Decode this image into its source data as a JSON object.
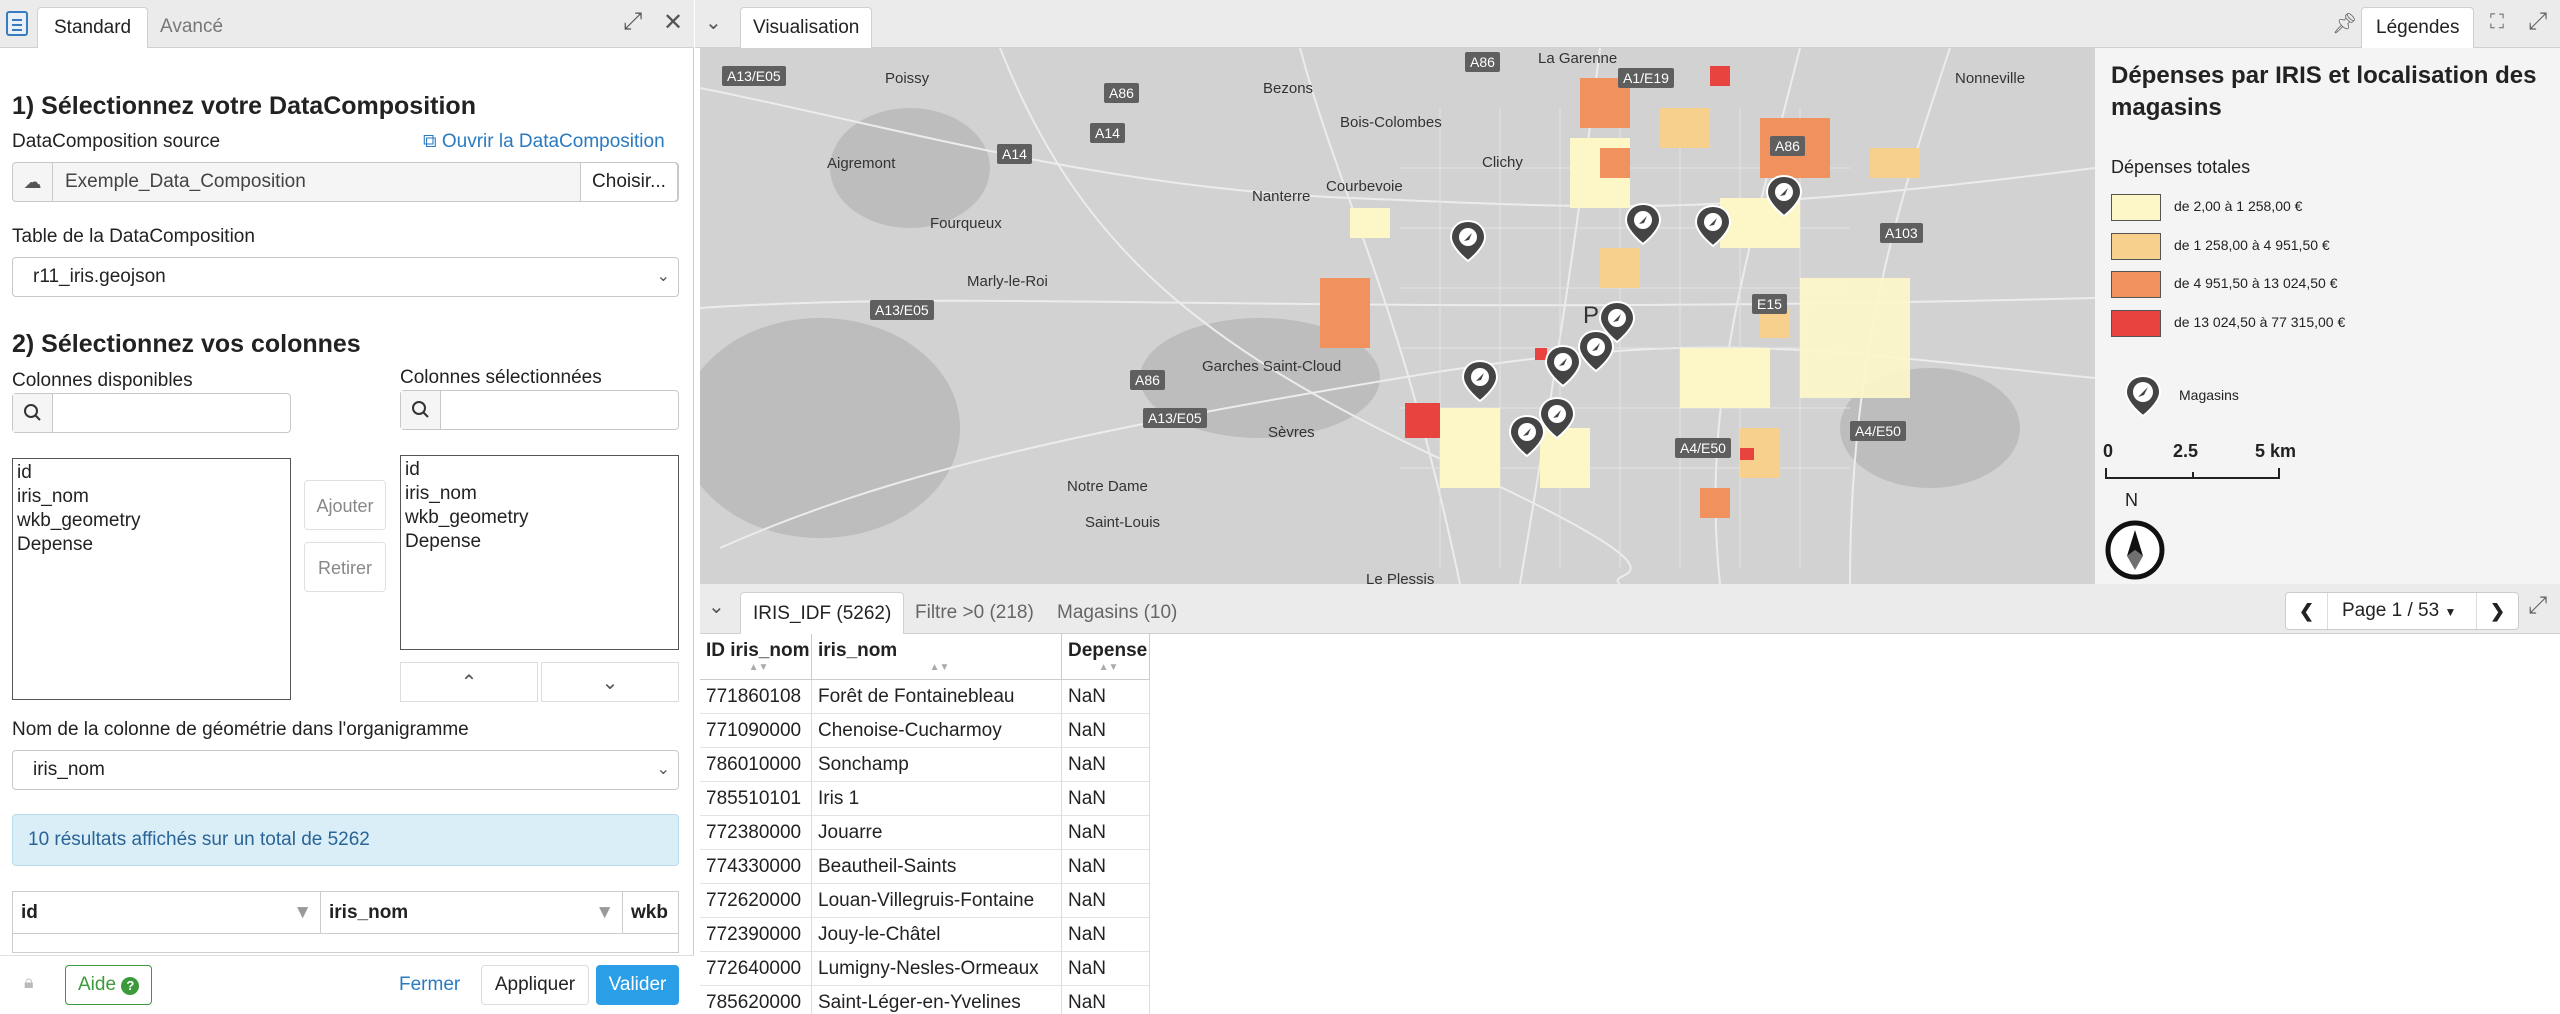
{
  "left_panel": {
    "tabs": [
      "Standard",
      "Avancé"
    ],
    "section1_title": "1) Sélectionnez votre DataComposition",
    "source_label": "DataComposition source",
    "open_link": "Ouvrir la DataComposition",
    "source_value": "Exemple_Data_Composition",
    "choose_button": "Choisir...",
    "table_label": "Table de la DataComposition",
    "table_value": "r11_iris.geojson",
    "section2_title": "2) Sélectionnez vos colonnes",
    "available_label": "Colonnes disponibles",
    "selected_label": "Colonnes sélectionnées",
    "available_columns": [
      "id",
      "iris_nom",
      "wkb_geometry",
      "Depense"
    ],
    "selected_columns": [
      "id",
      "iris_nom",
      "wkb_geometry",
      "Depense"
    ],
    "add_button": "Ajouter",
    "remove_button": "Retirer",
    "geometry_label": "Nom de la colonne de géométrie dans l'organigramme",
    "geometry_value": "iris_nom",
    "info_text": "10 résultats affichés sur un total de 5262",
    "table_headers": [
      "id",
      "iris_nom",
      "wkb"
    ],
    "footer": {
      "help": "Aide",
      "close": "Fermer",
      "apply": "Appliquer",
      "validate": "Valider"
    }
  },
  "right_panel": {
    "visualisation_tab": "Visualisation",
    "legend_tab": "Légendes",
    "legend": {
      "title": "Dépenses par IRIS et localisation des magasins",
      "subtitle": "Dépenses totales",
      "classes": [
        {
          "label": "de 2,00 à 1 258,00 €",
          "color": "#fdf7c8"
        },
        {
          "label": "de 1 258,00 à 4 951,50 €",
          "color": "#f8d08e"
        },
        {
          "label": "de 4 951,50 à 13 024,50 €",
          "color": "#f0915e"
        },
        {
          "label": "de 13 024,50 à 77 315,00 €",
          "color": "#e8433e"
        }
      ],
      "stores_label": "Magasins",
      "scale_labels": [
        "0",
        "2.5",
        "5 km"
      ],
      "north_label": "N"
    },
    "map": {
      "roads": [
        "A13/E05",
        "A14",
        "A86",
        "A1/E19",
        "A86",
        "A14",
        "A13/E05",
        "A86",
        "A13/E05",
        "A103",
        "A4/E50",
        "A4/E50",
        "E15",
        "A86"
      ],
      "places": [
        "Poissy",
        "Bezons",
        "La Garenne",
        "Bois-Colombes",
        "Courbevoie",
        "Clichy",
        "Nanterre",
        "Aigremont",
        "Fourqueux",
        "Marly-le-Roi",
        "Garches Saint-Cloud",
        "Sèvres",
        "Notre Dame",
        "Saint-Louis",
        "Le Plessis",
        "Nonneville",
        "Pa"
      ]
    },
    "table_tabs": [
      "IRIS_IDF (5262)",
      "Filtre >0 (218)",
      "Magasins (10)"
    ],
    "pagination": "Page 1 / 53",
    "table_headers": [
      "ID iris_nom",
      "iris_nom",
      "Depense"
    ],
    "rows": [
      [
        "771860108",
        "Forêt de Fontainebleau",
        "NaN"
      ],
      [
        "771090000",
        "Chenoise-Cucharmoy",
        "NaN"
      ],
      [
        "786010000",
        "Sonchamp",
        "NaN"
      ],
      [
        "785510101",
        "Iris 1",
        "NaN"
      ],
      [
        "772380000",
        "Jouarre",
        "NaN"
      ],
      [
        "774330000",
        "Beautheil-Saints",
        "NaN"
      ],
      [
        "772620000",
        "Louan-Villegruis-Fontaine",
        "NaN"
      ],
      [
        "772390000",
        "Jouy-le-Châtel",
        "NaN"
      ],
      [
        "772640000",
        "Lumigny-Nesles-Ormeaux",
        "NaN"
      ],
      [
        "785620000",
        "Saint-Léger-en-Yvelines",
        "NaN"
      ]
    ]
  }
}
